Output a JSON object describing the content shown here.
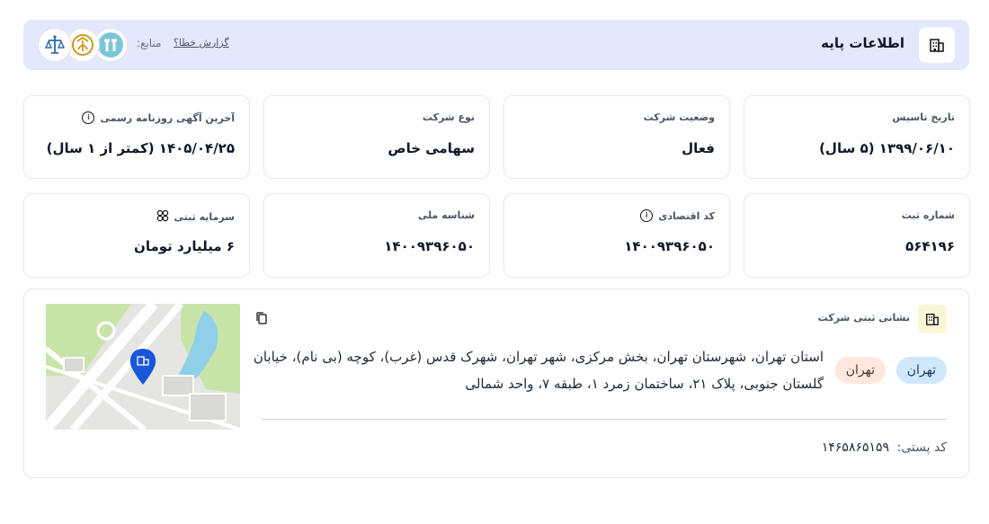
{
  "header": {
    "title": "اطلاعات پایه",
    "report_link": "گزارش خطا؟",
    "sources_label": "منابع:",
    "icon": "building-icon",
    "sources": [
      "tt-logo-icon",
      "emblem-icon",
      "scales-icon"
    ],
    "colors": {
      "background": "#e3e8fc"
    }
  },
  "cards_row1": [
    {
      "label": "تاریخ تاسیس",
      "value": "۱۳۹۹/۰۶/۱۰ (۵ سال)",
      "info": false
    },
    {
      "label": "وضعیت شرکت",
      "value": "فعال",
      "info": false
    },
    {
      "label": "نوع شرکت",
      "value": "سهامی خاص",
      "info": false
    },
    {
      "label": "آخرین آگهی روزنامه رسمی",
      "value": "۱۴۰۵/۰۴/۲۵ (کمتر از ۱ سال)",
      "info": true
    }
  ],
  "cards_row2": [
    {
      "label": "شماره ثبت",
      "value": "۵۶۴۱۹۶",
      "info": false
    },
    {
      "label": "کد اقتصادی",
      "value": "۱۴۰۰۹۳۹۶۰۵۰",
      "info": true
    },
    {
      "label": "شناسه ملی",
      "value": "۱۴۰۰۹۳۹۶۰۵۰",
      "info": false
    },
    {
      "label": "سرمایه ثبتی",
      "value": "۶ میلیارد تومان",
      "info": false,
      "icon": "coins-icon"
    }
  ],
  "address": {
    "title": "نشانی ثبتی شرکت",
    "chips": [
      "تهران",
      "تهران"
    ],
    "text": "استان تهران، شهرستان تهران، بخش مرکزی، شهر تهران، شهرک قدس (غرب)، کوچه (بی نام)، خیابان گلستان جنوبی، پلاک ۲۱، ساختمان زمرد ۱، طبقه ۷، واحد شمالی",
    "postal_label": "کد پستی:",
    "postal_code": "۱۴۶۵۸۶۵۱۵۹",
    "colors": {
      "chip_blue": "#cfe8fb",
      "chip_orange": "#fde7de",
      "pin": "#1a56db"
    }
  }
}
